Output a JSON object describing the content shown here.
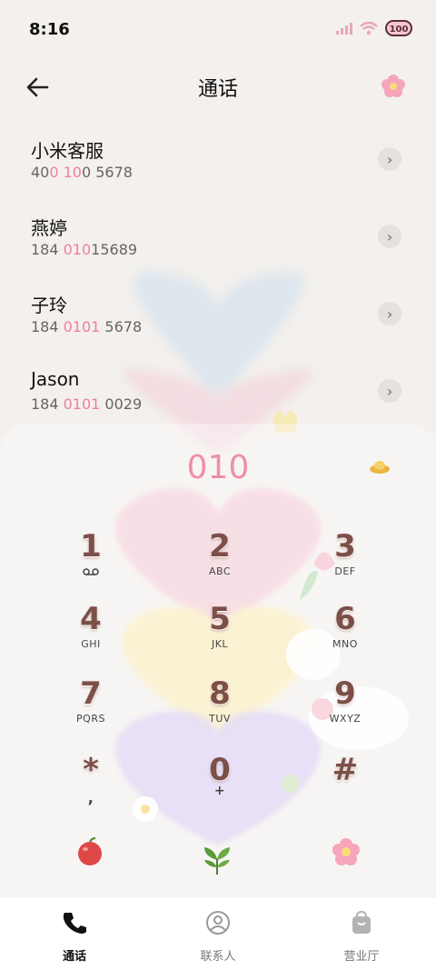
{
  "status": {
    "time": "8:16",
    "battery": "100"
  },
  "header": {
    "title": "通话",
    "back_icon": "back-arrow-icon",
    "theme_icon": "flower-icon"
  },
  "contacts": [
    {
      "name": "小米客服",
      "num_parts": [
        "40",
        "0 10",
        "0 5678"
      ]
    },
    {
      "name": "燕婷",
      "num_parts": [
        "184 ",
        "010",
        "15689"
      ]
    },
    {
      "name": "子玲",
      "num_parts": [
        "184 ",
        "0101",
        " 5678"
      ]
    },
    {
      "name": "Jason",
      "num_parts": [
        "184 ",
        "0101",
        " 0029"
      ]
    }
  ],
  "dial": {
    "input": "010"
  },
  "keys": [
    {
      "digit": "1",
      "letters": "voicemail-icon"
    },
    {
      "digit": "2",
      "letters": "ABC"
    },
    {
      "digit": "3",
      "letters": "DEF"
    },
    {
      "digit": "4",
      "letters": "GHI"
    },
    {
      "digit": "5",
      "letters": "JKL"
    },
    {
      "digit": "6",
      "letters": "MNO"
    },
    {
      "digit": "7",
      "letters": "PQRS"
    },
    {
      "digit": "8",
      "letters": "TUV"
    },
    {
      "digit": "9",
      "letters": "WXYZ"
    },
    {
      "digit": "*",
      "letters": ","
    },
    {
      "digit": "0",
      "letters": "+"
    },
    {
      "digit": "#",
      "letters": ""
    }
  ],
  "tabs": [
    {
      "label": "通话",
      "icon": "phone-icon",
      "active": true
    },
    {
      "label": "联系人",
      "icon": "contacts-icon",
      "active": false
    },
    {
      "label": "营业厅",
      "icon": "bag-icon",
      "active": false
    }
  ],
  "colors": {
    "accent": "#ef7f9b",
    "digit": "#7c4f48"
  }
}
